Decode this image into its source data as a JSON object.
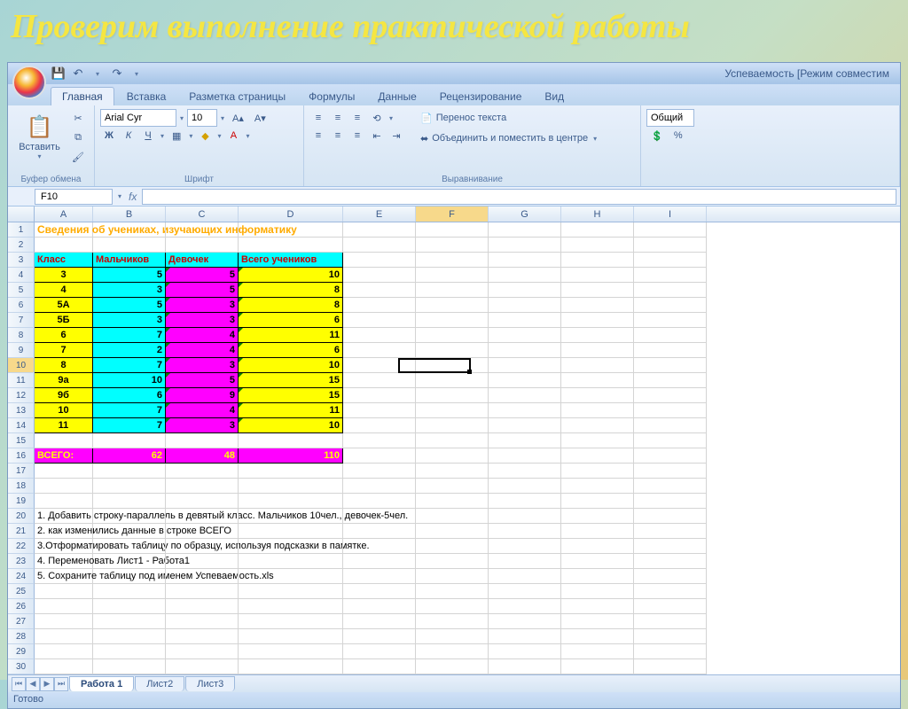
{
  "slide_title": "Проверим выполнение практической работы",
  "doc_title": "Успеваемость  [Режим совместим",
  "tabs": [
    "Главная",
    "Вставка",
    "Разметка страницы",
    "Формулы",
    "Данные",
    "Рецензирование",
    "Вид"
  ],
  "active_tab": 0,
  "ribbon": {
    "paste": "Вставить",
    "clipboard_title": "Буфер обмена",
    "font_title": "Шрифт",
    "align_title": "Выравнивание",
    "number_title": "",
    "font_name": "Arial Cyr",
    "font_size": "10",
    "bold": "Ж",
    "italic": "К",
    "underline": "Ч",
    "wrap": "Перенос текста",
    "merge": "Объединить и поместить в центре",
    "numfmt": "Общий"
  },
  "namebox": "F10",
  "columns": [
    "A",
    "B",
    "C",
    "D",
    "E",
    "F",
    "G",
    "H",
    "I"
  ],
  "sheet_title_text": "Сведения об учениках, изучающих информатику",
  "headers": {
    "klass": "Класс",
    "boys": "Мальчиков",
    "girls": "Девочек",
    "total": "Всего учеников"
  },
  "rows": [
    {
      "klass": "3",
      "boys": "5",
      "girls": "5",
      "total": "10"
    },
    {
      "klass": "4",
      "boys": "3",
      "girls": "5",
      "total": "8"
    },
    {
      "klass": "5А",
      "boys": "5",
      "girls": "3",
      "total": "8"
    },
    {
      "klass": "5Б",
      "boys": "3",
      "girls": "3",
      "total": "6"
    },
    {
      "klass": "6",
      "boys": "7",
      "girls": "4",
      "total": "11"
    },
    {
      "klass": "7",
      "boys": "2",
      "girls": "4",
      "total": "6"
    },
    {
      "klass": "8",
      "boys": "7",
      "girls": "3",
      "total": "10"
    },
    {
      "klass": "9а",
      "boys": "10",
      "girls": "5",
      "total": "15"
    },
    {
      "klass": "9б",
      "boys": "6",
      "girls": "9",
      "total": "15"
    },
    {
      "klass": "10",
      "boys": "7",
      "girls": "4",
      "total": "11"
    },
    {
      "klass": "11",
      "boys": "7",
      "girls": "3",
      "total": "10"
    }
  ],
  "totals": {
    "label": "ВСЕГО:",
    "boys": "62",
    "girls": "48",
    "total": "110"
  },
  "notes": [
    "1. Добавить строку-параллель в девятый   класс. Мальчиков 10чел., девочек-5чел.",
    "2. как изменились данные в строке ВСЕГО",
    "3.Отформатировать таблицу по образцу, используя подсказки в памятке.",
    "4. Переменовать Лист1 -  Работа1",
    "5.   Сохраните таблицу под именем Успеваемость.xls"
  ],
  "sheets": [
    "Работа 1",
    "Лист2",
    "Лист3"
  ],
  "status": "Готово"
}
